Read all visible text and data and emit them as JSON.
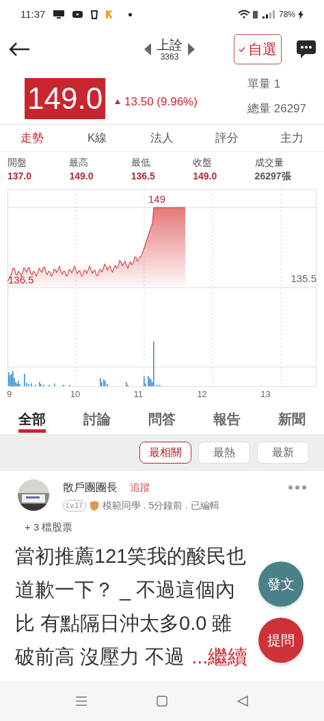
{
  "status_bar": {
    "time": "11:37",
    "battery": "78%"
  },
  "header": {
    "name": "上詮",
    "code": "3363",
    "watch_button": {
      "label": "自選",
      "checked": true
    }
  },
  "quote": {
    "price": "149.0",
    "change": "13.50 (9.96%)",
    "unit_label": "單量",
    "unit_value": "1",
    "total_label": "總量",
    "total_value": "26297"
  },
  "chart_tabs": [
    {
      "label": "走勢",
      "selected": true
    },
    {
      "label": "K線",
      "selected": false
    },
    {
      "label": "法人",
      "selected": false
    },
    {
      "label": "評分",
      "selected": false
    },
    {
      "label": "主力",
      "selected": false
    }
  ],
  "stats": [
    {
      "label": "開盤",
      "value": "137.0",
      "kind": "up"
    },
    {
      "label": "最高",
      "value": "149.0",
      "kind": "up"
    },
    {
      "label": "最低",
      "value": "136.5",
      "kind": "up"
    },
    {
      "label": "收盤",
      "value": "149.0",
      "kind": "up"
    },
    {
      "label": "成交量",
      "value": "26297張",
      "kind": "plain"
    }
  ],
  "chart": {
    "high_label": "149",
    "low_label": "136.5",
    "right_label": "135.5",
    "x_labels": [
      "9",
      "10",
      "11",
      "12",
      "13"
    ]
  },
  "content_tabs": [
    {
      "label": "全部",
      "selected": true
    },
    {
      "label": "討論",
      "selected": false
    },
    {
      "label": "問答",
      "selected": false
    },
    {
      "label": "報告",
      "selected": false
    },
    {
      "label": "新聞",
      "selected": false
    }
  ],
  "sort_options": [
    {
      "label": "最相關",
      "selected": true
    },
    {
      "label": "最熱",
      "selected": false
    },
    {
      "label": "最新",
      "selected": false
    }
  ],
  "post": {
    "author": "散戶團團長",
    "follow": "追蹤",
    "level": "Lv.17",
    "meta": "模範同學 . 5分鐘前 . 已編輯",
    "stocks": "+ 3 檔股票",
    "lines": [
      "當初推薦121笑我的酸民也",
      "道歉一下？ _ 不過這個內",
      "比 有點隔日沖太多0.0 雖",
      "破前高 沒壓力 不過"
    ],
    "read_more": "...繼續"
  },
  "fabs": [
    {
      "label": "發文",
      "color": "#4a8088"
    },
    {
      "label": "提問",
      "color": "#cc3238"
    }
  ]
}
